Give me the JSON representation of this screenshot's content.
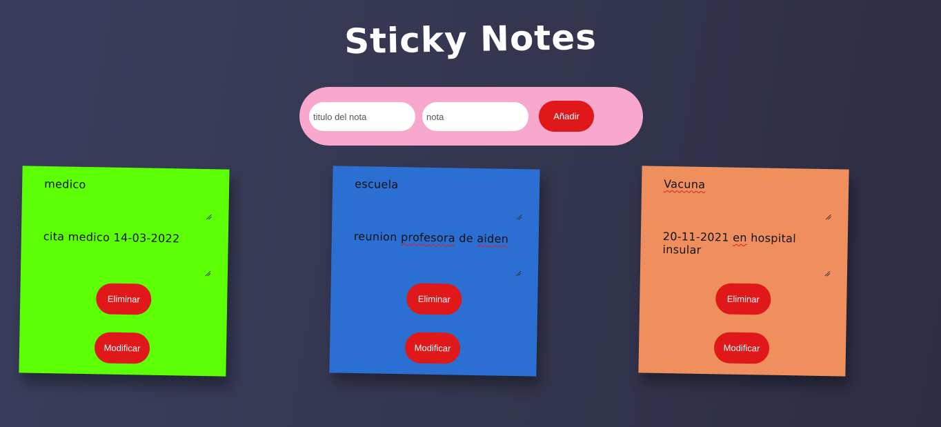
{
  "app": {
    "title": "Sticky Notes"
  },
  "form": {
    "title_placeholder": "titulo del nota",
    "note_placeholder": "nota",
    "add_label": "Añadir"
  },
  "notes": [
    {
      "title": "medico",
      "body": "cita medico 14-03-2022",
      "color": "#5cff03",
      "delete_label": "Eliminar",
      "modify_label": "Modificar"
    },
    {
      "title": "escuela",
      "body_parts": [
        "reunion ",
        "profesora",
        " de ",
        "aiden"
      ],
      "color": "#2a6fd1",
      "delete_label": "Eliminar",
      "modify_label": "Modificar"
    },
    {
      "title": "Vacuna",
      "body_parts": [
        "20-11-2021 ",
        "en",
        " hospital insular"
      ],
      "color": "#ef8f5d",
      "delete_label": "Eliminar",
      "modify_label": "Modificar"
    }
  ],
  "colors": {
    "accent_button": "#e0181a",
    "form_background": "#f8a8cd",
    "page_background": "#34364f"
  }
}
